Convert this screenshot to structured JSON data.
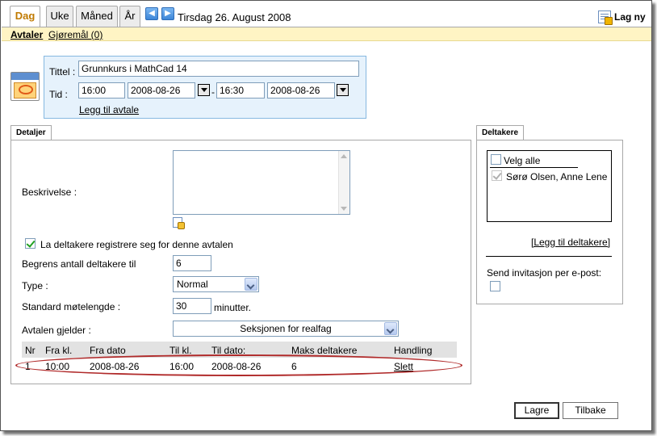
{
  "tabs": [
    {
      "label": "Dag",
      "active": true
    },
    {
      "label": "Uke",
      "active": false
    },
    {
      "label": "Måned",
      "active": false
    },
    {
      "label": "År",
      "active": false
    }
  ],
  "nav": {
    "prev_icon": "arrow-left-icon",
    "next_icon": "arrow-right-icon"
  },
  "date_title": "Tirsdag 26. August 2008",
  "new_button": {
    "label": "Lag ny",
    "icon": "new-appointment-icon"
  },
  "subnav": {
    "appointments": "Avtaler",
    "tasks": "Gjøremål (0)"
  },
  "header_form": {
    "title_label": "Tittel :",
    "title_value": "Grunnkurs i MathCad 14",
    "time_label": "Tid :",
    "start_time": "16:00",
    "start_date": "2008-08-26",
    "separator": "-",
    "end_time": "16:30",
    "end_date": "2008-08-26",
    "add_link": "Legg til avtale"
  },
  "details": {
    "tab_label": "Detaljer",
    "description_label": "Beskrivelse :",
    "register_label": "La deltakere registrere seg for denne avtalen",
    "register_checked": true,
    "limit_label": "Begrens antall deltakere til",
    "limit_value": "6",
    "type_label": "Type :",
    "type_value": "Normal",
    "duration_label": "Standard møtelengde :",
    "duration_value": "30",
    "duration_unit": "minutter.",
    "applies_label": "Avtalen gjelder :",
    "applies_value": "Seksjonen for realfag"
  },
  "table": {
    "headers": [
      "Nr",
      "Fra kl.",
      "Fra dato",
      "Til kl.",
      "Til dato:",
      "Maks deltakere",
      "Handling"
    ],
    "rows": [
      {
        "nr": "1",
        "from_time": "10:00",
        "from_date": "2008-08-26",
        "to_time": "16:00",
        "to_date": "2008-08-26",
        "max": "6",
        "action": "Slett"
      }
    ]
  },
  "participants": {
    "tab_label": "Deltakere",
    "select_all": "Velg alle",
    "items": [
      {
        "name": "Sørø Olsen, Anne Lene",
        "checked": true
      }
    ],
    "add_link": "[Legg til deltakere]",
    "invite_label": "Send invitasjon per e-post:"
  },
  "buttons": {
    "save": "Lagre",
    "back": "Tilbake"
  },
  "colors": {
    "active_tab": "#c07a00",
    "subbar_bg": "#fff4c4",
    "header_box_bg": "#e6f2fc",
    "ring": "#b02a2a"
  }
}
